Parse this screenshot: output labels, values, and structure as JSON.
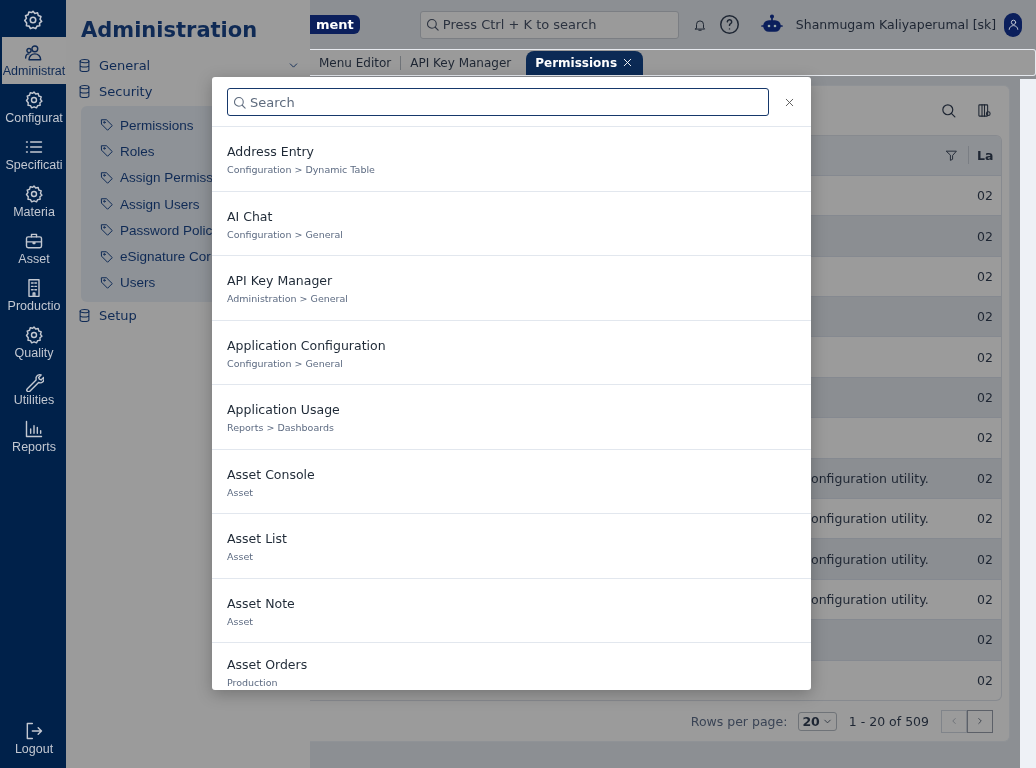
{
  "rail": {
    "items": [
      {
        "label": "Administrat",
        "selected": true
      },
      {
        "label": "Configurat",
        "selected": false
      },
      {
        "label": "Specificati",
        "selected": false
      },
      {
        "label": "Materia",
        "selected": false
      },
      {
        "label": "Asset",
        "selected": false
      },
      {
        "label": "Productio",
        "selected": false
      },
      {
        "label": "Quality",
        "selected": false
      },
      {
        "label": "Utilities",
        "selected": false
      },
      {
        "label": "Reports",
        "selected": false
      }
    ],
    "logout": "Logout"
  },
  "flyout": {
    "title": "Administration",
    "tree": [
      {
        "label": "General",
        "show_chevron": true
      },
      {
        "label": "Security",
        "show_chevron": false,
        "expanded": true,
        "children": [
          {
            "label": "Permissions"
          },
          {
            "label": "Roles"
          },
          {
            "label": "Assign Permiss"
          },
          {
            "label": "Assign Users"
          },
          {
            "label": "Password Polic"
          },
          {
            "label": "eSignature Cor"
          },
          {
            "label": "Users"
          }
        ]
      },
      {
        "label": "Setup",
        "show_chevron": false
      }
    ]
  },
  "header": {
    "badge": "ment",
    "search_placeholder": "Press Ctrl + K to search",
    "user": "Shanmugam Kaliyaperumal [sk]"
  },
  "tabs": [
    {
      "label": "Menu Editor",
      "selected": false,
      "closable": false
    },
    {
      "label": "API Key Manager",
      "selected": false,
      "closable": false
    },
    {
      "label": "Permissions",
      "selected": true,
      "closable": true
    }
  ],
  "table": {
    "last_column": "La",
    "rows": [
      {
        "last": "02"
      },
      {
        "last": "02"
      },
      {
        "last": "02"
      },
      {
        "last": "02"
      },
      {
        "last": "02"
      },
      {
        "last": "02"
      },
      {
        "last": "02"
      },
      {
        "description": "onfiguration utility.",
        "last": "02"
      },
      {
        "description": "onfiguration utility.",
        "last": "02"
      },
      {
        "description": "onfiguration utility.",
        "last": "02"
      },
      {
        "description": "onfiguration utility.",
        "last": "02"
      },
      {
        "last": "02"
      },
      {
        "last": "02"
      }
    ]
  },
  "pager": {
    "label": "Rows per page:",
    "page_size": "20",
    "range": "1 - 20 of 509"
  },
  "modal": {
    "search_placeholder": "Search",
    "results": [
      {
        "title": "Address Entry",
        "path": "Configuration > Dynamic Table"
      },
      {
        "title": "AI Chat",
        "path": "Configuration > General"
      },
      {
        "title": "API Key Manager",
        "path": "Administration > General"
      },
      {
        "title": "Application Configuration",
        "path": "Configuration > General"
      },
      {
        "title": "Application Usage",
        "path": "Reports > Dashboards"
      },
      {
        "title": "Asset Console",
        "path": "Asset"
      },
      {
        "title": "Asset List",
        "path": "Asset"
      },
      {
        "title": "Asset Note",
        "path": "Asset"
      },
      {
        "title": "Asset Orders",
        "path": "Production"
      }
    ]
  }
}
